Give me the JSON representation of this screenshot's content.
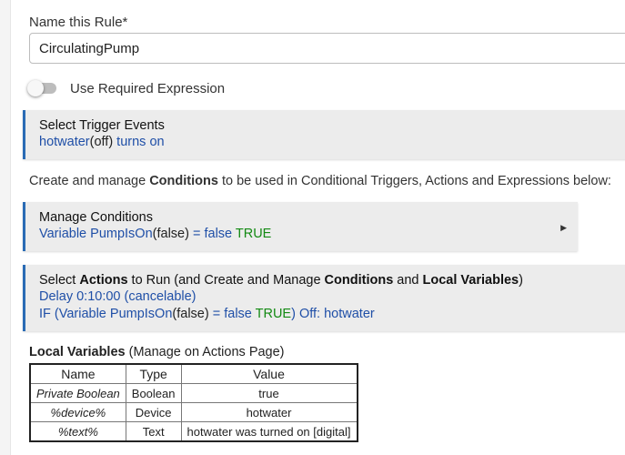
{
  "rule": {
    "name_label": "Name this Rule*",
    "name_value": "CirculatingPump"
  },
  "required_expression": {
    "label": "Use Required Expression",
    "enabled": false
  },
  "trigger": {
    "title": "Select Trigger Events",
    "line_device": "hotwater",
    "line_state": "(off)",
    "line_event": " turns on"
  },
  "conditions_info": {
    "prefix": "Create and manage ",
    "bold": "Conditions",
    "suffix": " to be used in Conditional Triggers, Actions and Expressions below:"
  },
  "manage_conditions": {
    "title": "Manage Conditions",
    "cond_var": "Variable PumpIsOn",
    "cond_state": "(false)",
    "cond_eq": " = false ",
    "cond_result": "TRUE"
  },
  "actions": {
    "title_1": "Select ",
    "title_2": "Actions",
    "title_3": " to Run (and Create and Manage ",
    "title_4": "Conditions",
    "title_5": " and ",
    "title_6": "Local Variables",
    "title_7": ")",
    "line1": "Delay 0:10:00 (cancelable)",
    "l2_a": "IF (Variable PumpIsOn",
    "l2_b": "(false)",
    "l2_c": " = false ",
    "l2_d": "TRUE",
    "l2_e": ") Off: hotwater"
  },
  "local_variables": {
    "title_bold": "Local Variables",
    "title_rest": " (Manage on Actions Page)",
    "headers": [
      "Name",
      "Type",
      "Value"
    ],
    "rows": [
      {
        "name": "Private Boolean",
        "type": "Boolean",
        "value": "true"
      },
      {
        "name": "%device%",
        "type": "Device",
        "value": "hotwater"
      },
      {
        "name": "%text%",
        "type": "Text",
        "value": "hotwater was turned on [digital]"
      }
    ]
  },
  "colors": {
    "accent": "#2a6bb5",
    "link_blue": "#1f4fa7",
    "true_green": "#138a13",
    "card_bg": "#ececec"
  }
}
